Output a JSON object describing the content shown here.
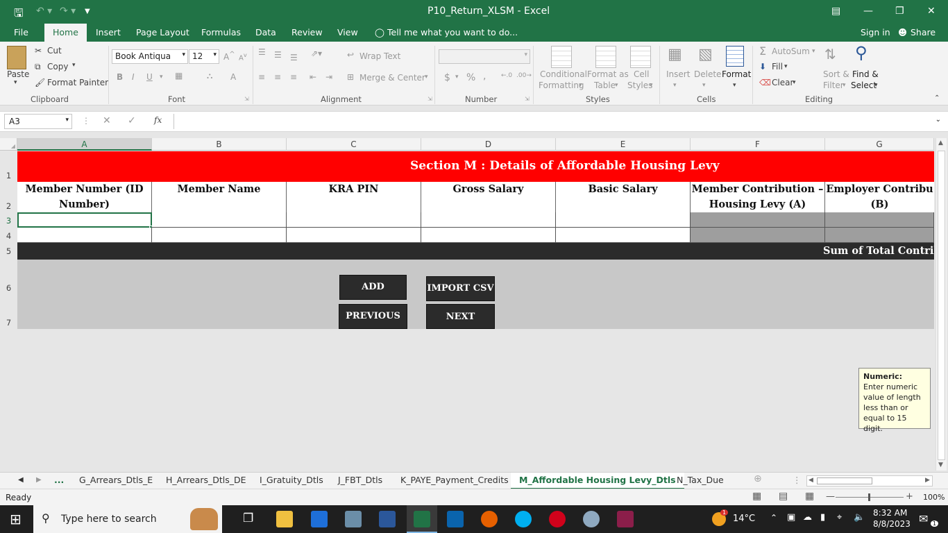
{
  "window": {
    "title": "P10_Return_XLSM - Excel"
  },
  "menu": {
    "tabs": [
      "File",
      "Home",
      "Insert",
      "Page Layout",
      "Formulas",
      "Data",
      "Review",
      "View"
    ],
    "tell_me": "Tell me what you want to do...",
    "sign_in": "Sign in",
    "share": "Share"
  },
  "ribbon": {
    "clipboard": {
      "paste": "Paste",
      "cut": "Cut",
      "copy": "Copy",
      "format_painter": "Format Painter",
      "group": "Clipboard"
    },
    "font": {
      "name": "Book Antiqua",
      "size": "12",
      "group": "Font"
    },
    "alignment": {
      "wrap_text": "Wrap Text",
      "merge_center": "Merge & Center",
      "group": "Alignment"
    },
    "number": {
      "group": "Number",
      "percent": "%",
      "comma": ",",
      "currency": "$"
    },
    "styles": {
      "conditional": "Conditional",
      "formatting": "Formatting",
      "format_as": "Format as",
      "table": "Table",
      "cell": "Cell",
      "cell_styles": "Styles",
      "group": "Styles"
    },
    "cells": {
      "insert": "Insert",
      "delete": "Delete",
      "format": "Format",
      "group": "Cells"
    },
    "editing": {
      "autosum": "AutoSum",
      "fill": "Fill",
      "clear": "Clear",
      "sort": "Sort &",
      "filter": "Filter",
      "find": "Find &",
      "select": "Select",
      "group": "Editing"
    }
  },
  "formula_bar": {
    "name_box": "A3",
    "fx": "fx",
    "value": ""
  },
  "columns": [
    "A",
    "B",
    "C",
    "D",
    "E",
    "F",
    "G"
  ],
  "rows": [
    "1",
    "2",
    "3",
    "4",
    "5",
    "6",
    "7"
  ],
  "sheet": {
    "title": "Section M : Details of Affordable Housing Levy",
    "headers": [
      {
        "l1": "Member Number (ID",
        "l2": "Number)"
      },
      {
        "l1": "Member Name",
        "l2": ""
      },
      {
        "l1": "KRA PIN",
        "l2": ""
      },
      {
        "l1": "Gross Salary",
        "l2": ""
      },
      {
        "l1": "Basic Salary",
        "l2": ""
      },
      {
        "l1": "Member Contribution –",
        "l2": "Housing Levy (A)"
      },
      {
        "l1": "Employer Contribu",
        "l2": "(B)"
      }
    ],
    "sum_label": "Sum of Total Contrib",
    "buttons": {
      "add_rows": "ADD ROW(S)",
      "import_csv": "IMPORT CSV",
      "previous": "PREVIOUS",
      "next": "NEXT"
    },
    "tooltip": {
      "title": "Numeric:",
      "body": "Enter numeric value of length less than or equal to 15 digit."
    }
  },
  "sheet_tabs": {
    "ellipsis": "...",
    "tabs": [
      "G_Arrears_Dtls_E",
      "H_Arrears_Dtls_DE",
      "I_Gratuity_Dtls",
      "J_FBT_Dtls",
      "K_PAYE_Payment_Credits",
      "M_Affordable Housing Levy_Dtls",
      "N_Tax_Due"
    ],
    "active_index": 5
  },
  "status": {
    "ready": "Ready",
    "zoom": "100%"
  },
  "taskbar": {
    "search": "Type here to search",
    "temperature": "14°C",
    "time": "8:32 AM",
    "date": "8/8/2023",
    "notif_count": "1"
  },
  "colors": {
    "excel_green": "#217346",
    "section_red": "#ff0000",
    "dark_bar": "#2b2b2b",
    "grey_fill": "#9e9e9e"
  }
}
